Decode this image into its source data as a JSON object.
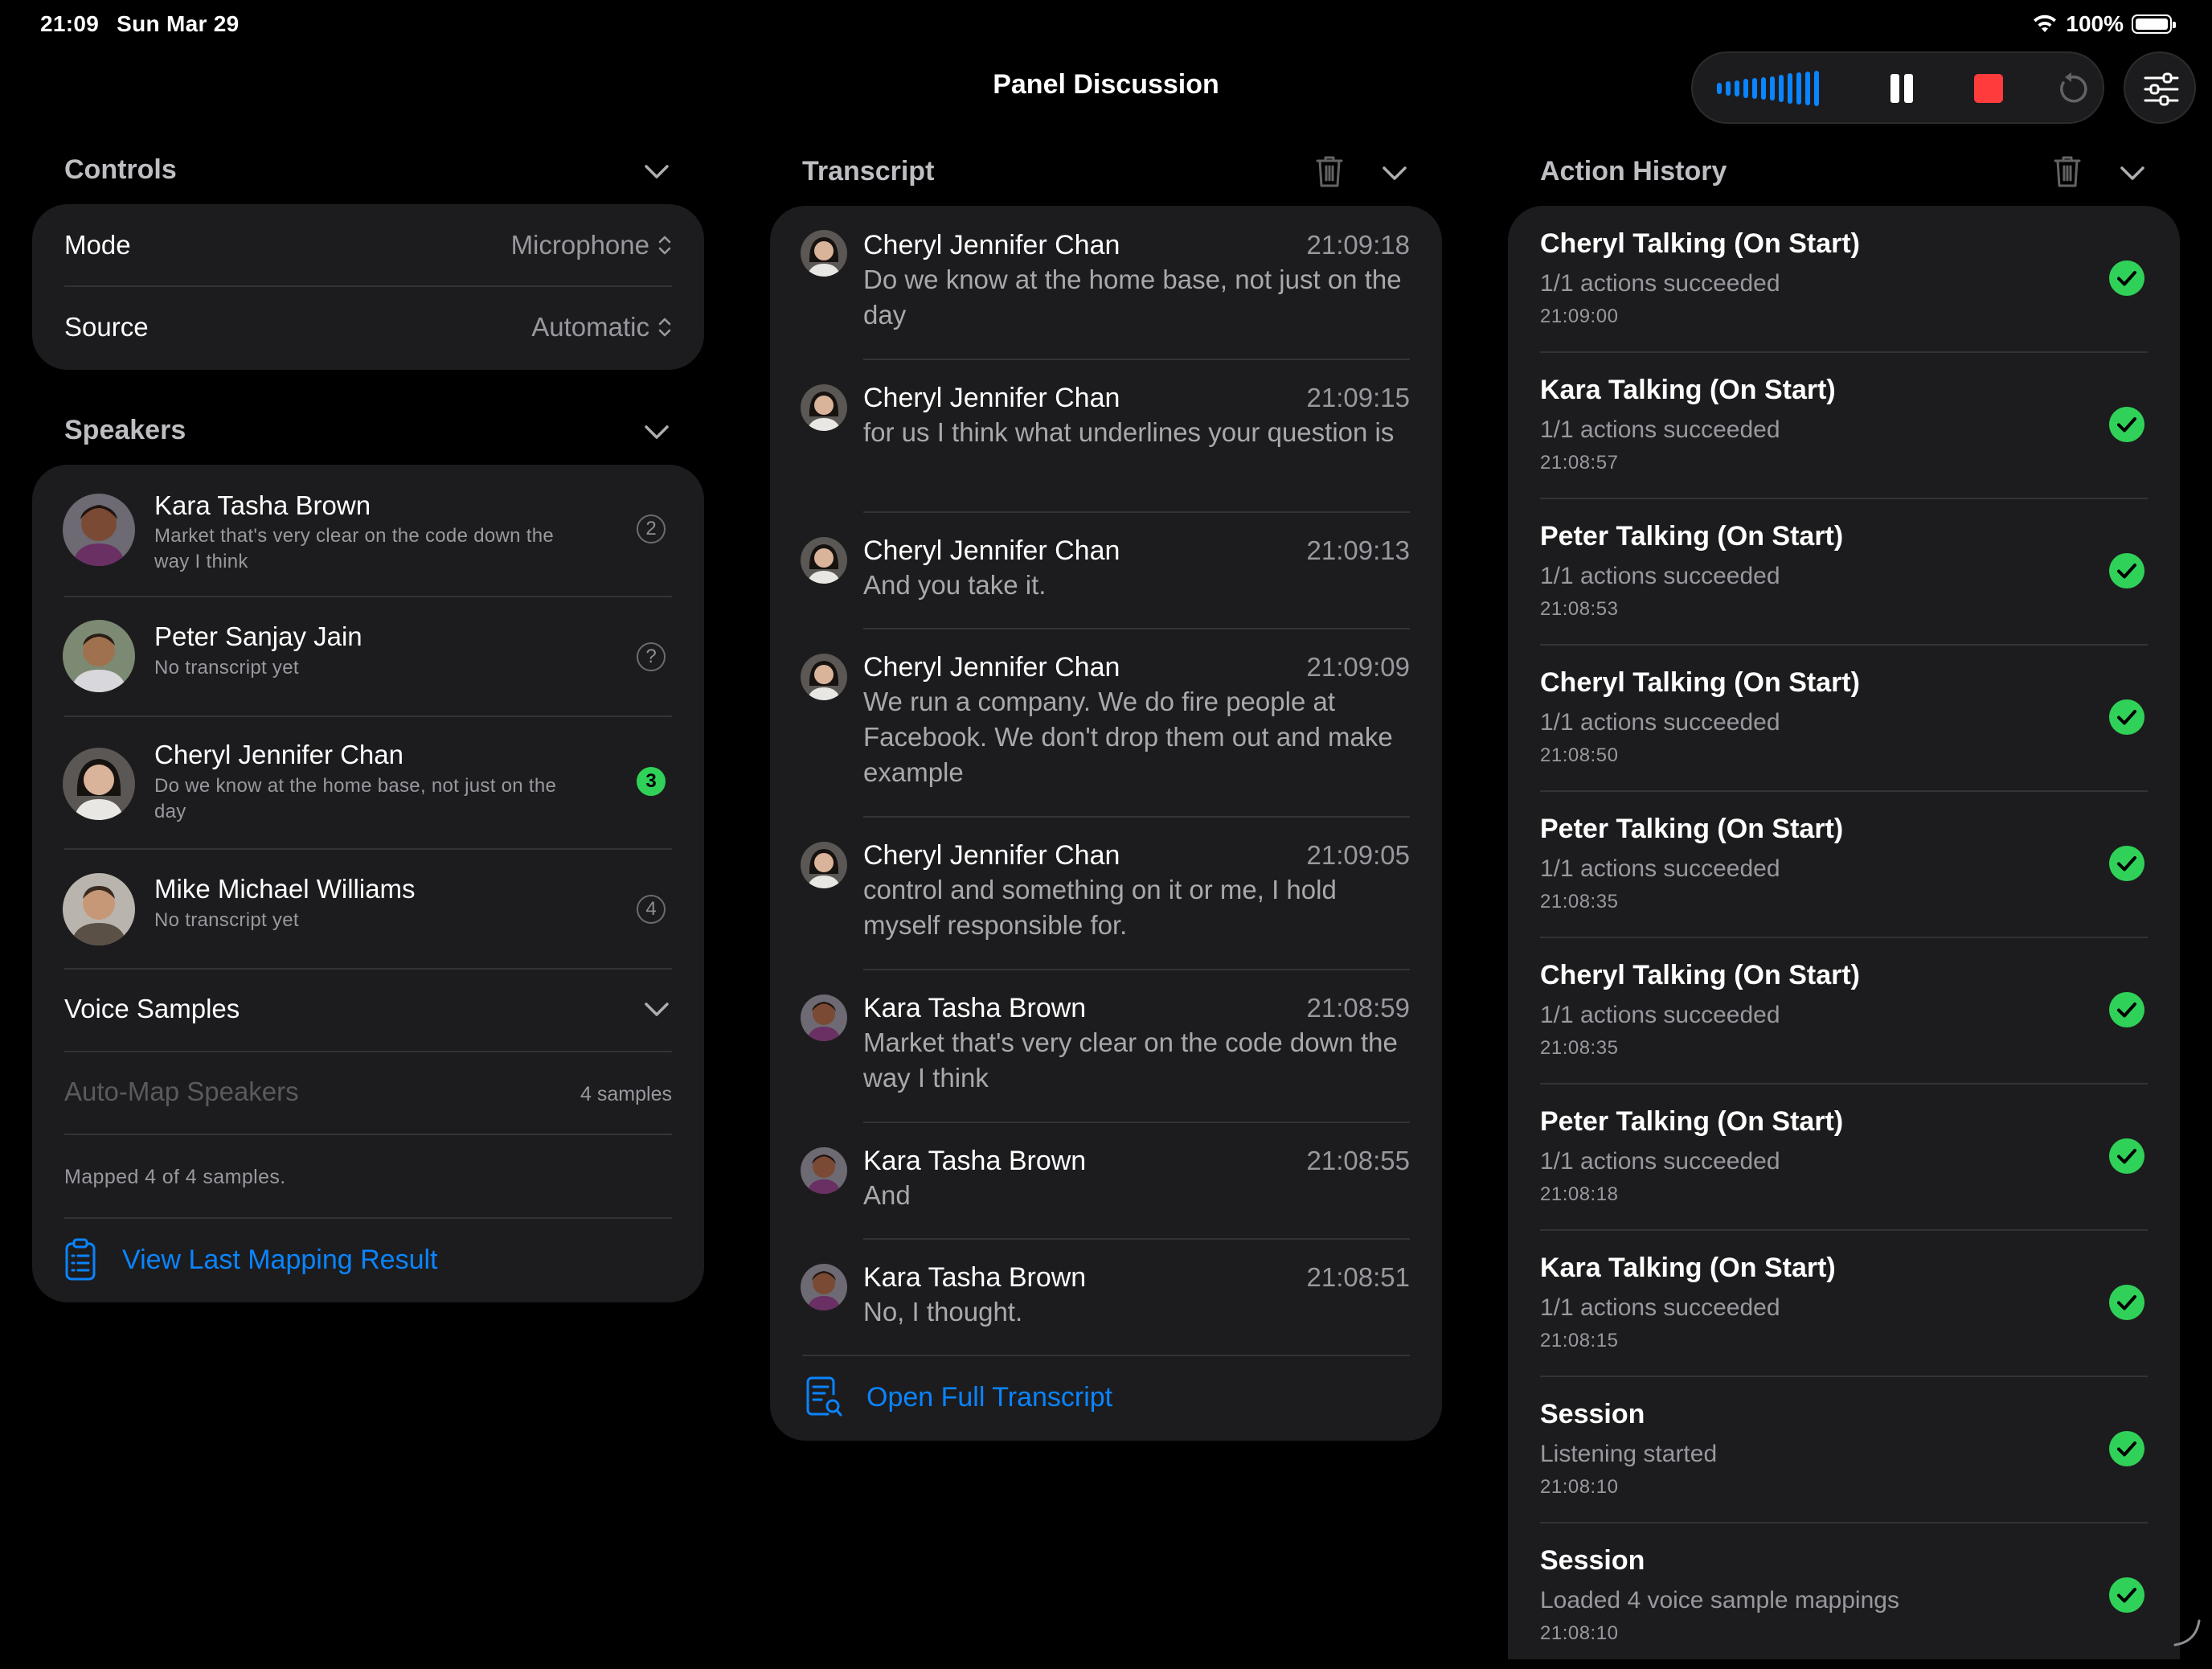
{
  "status_bar": {
    "time": "21:09",
    "date": "Sun Mar 29",
    "battery": "100%"
  },
  "title": "Panel Discussion",
  "controls": {
    "header": "Controls",
    "mode_label": "Mode",
    "mode_value": "Microphone",
    "source_label": "Source",
    "source_value": "Automatic"
  },
  "speakers": {
    "header": "Speakers",
    "items": [
      {
        "name": "Kara Tasha Brown",
        "subtitle": "Market that's very clear on the code down the way I think",
        "badge": "2",
        "active": false
      },
      {
        "name": "Peter Sanjay Jain",
        "subtitle": "No transcript yet",
        "badge": "?",
        "active": false
      },
      {
        "name": "Cheryl Jennifer Chan",
        "subtitle": "Do we know at the home base, not just on the day",
        "badge": "3",
        "active": true
      },
      {
        "name": "Mike Michael Williams",
        "subtitle": "No transcript yet",
        "badge": "4",
        "active": false
      }
    ],
    "voice_samples_label": "Voice Samples",
    "auto_map_label": "Auto-Map Speakers",
    "samples_count": "4 samples",
    "mapped_status": "Mapped 4 of 4 samples.",
    "view_mapping_label": "View Last Mapping Result"
  },
  "transcript": {
    "header": "Transcript",
    "entries": [
      {
        "speaker": "Cheryl Jennifer Chan",
        "time": "21:09:18",
        "text": "Do we know at the home base, not just on the day"
      },
      {
        "speaker": "Cheryl Jennifer Chan",
        "time": "21:09:15",
        "text": "for us I think what underlines your question is"
      },
      {
        "speaker": "Cheryl Jennifer Chan",
        "time": "21:09:13",
        "text": "And you take it."
      },
      {
        "speaker": "Cheryl Jennifer Chan",
        "time": "21:09:09",
        "text": "We run a company. We do fire people at Facebook. We don't drop them out and make example"
      },
      {
        "speaker": "Cheryl Jennifer Chan",
        "time": "21:09:05",
        "text": "control and something on it or me, I hold myself responsible for."
      },
      {
        "speaker": "Kara Tasha Brown",
        "time": "21:08:59",
        "text": "Market that's very clear on the code down the way I think"
      },
      {
        "speaker": "Kara Tasha Brown",
        "time": "21:08:55",
        "text": "And"
      },
      {
        "speaker": "Kara Tasha Brown",
        "time": "21:08:51",
        "text": "No, I thought."
      }
    ],
    "open_full_label": "Open Full Transcript"
  },
  "action_history": {
    "header": "Action History",
    "items": [
      {
        "title": "Cheryl Talking (On Start)",
        "subtitle": "1/1 actions succeeded",
        "time": "21:09:00"
      },
      {
        "title": "Kara Talking (On Start)",
        "subtitle": "1/1 actions succeeded",
        "time": "21:08:57"
      },
      {
        "title": "Peter Talking (On Start)",
        "subtitle": "1/1 actions succeeded",
        "time": "21:08:53"
      },
      {
        "title": "Cheryl Talking (On Start)",
        "subtitle": "1/1 actions succeeded",
        "time": "21:08:50"
      },
      {
        "title": "Peter Talking (On Start)",
        "subtitle": "1/1 actions succeeded",
        "time": "21:08:35"
      },
      {
        "title": "Cheryl Talking (On Start)",
        "subtitle": "1/1 actions succeeded",
        "time": "21:08:35"
      },
      {
        "title": "Peter Talking (On Start)",
        "subtitle": "1/1 actions succeeded",
        "time": "21:08:18"
      },
      {
        "title": "Kara Talking (On Start)",
        "subtitle": "1/1 actions succeeded",
        "time": "21:08:15"
      },
      {
        "title": "Session",
        "subtitle": "Listening started",
        "time": "21:08:10"
      },
      {
        "title": "Session",
        "subtitle": "Loaded 4 voice sample mappings",
        "time": "21:08:10"
      }
    ]
  },
  "colors": {
    "accent": "#0a84ff",
    "success": "#30d158",
    "stop": "#ff3b3b",
    "card": "#1c1c1e",
    "background": "#000000"
  }
}
